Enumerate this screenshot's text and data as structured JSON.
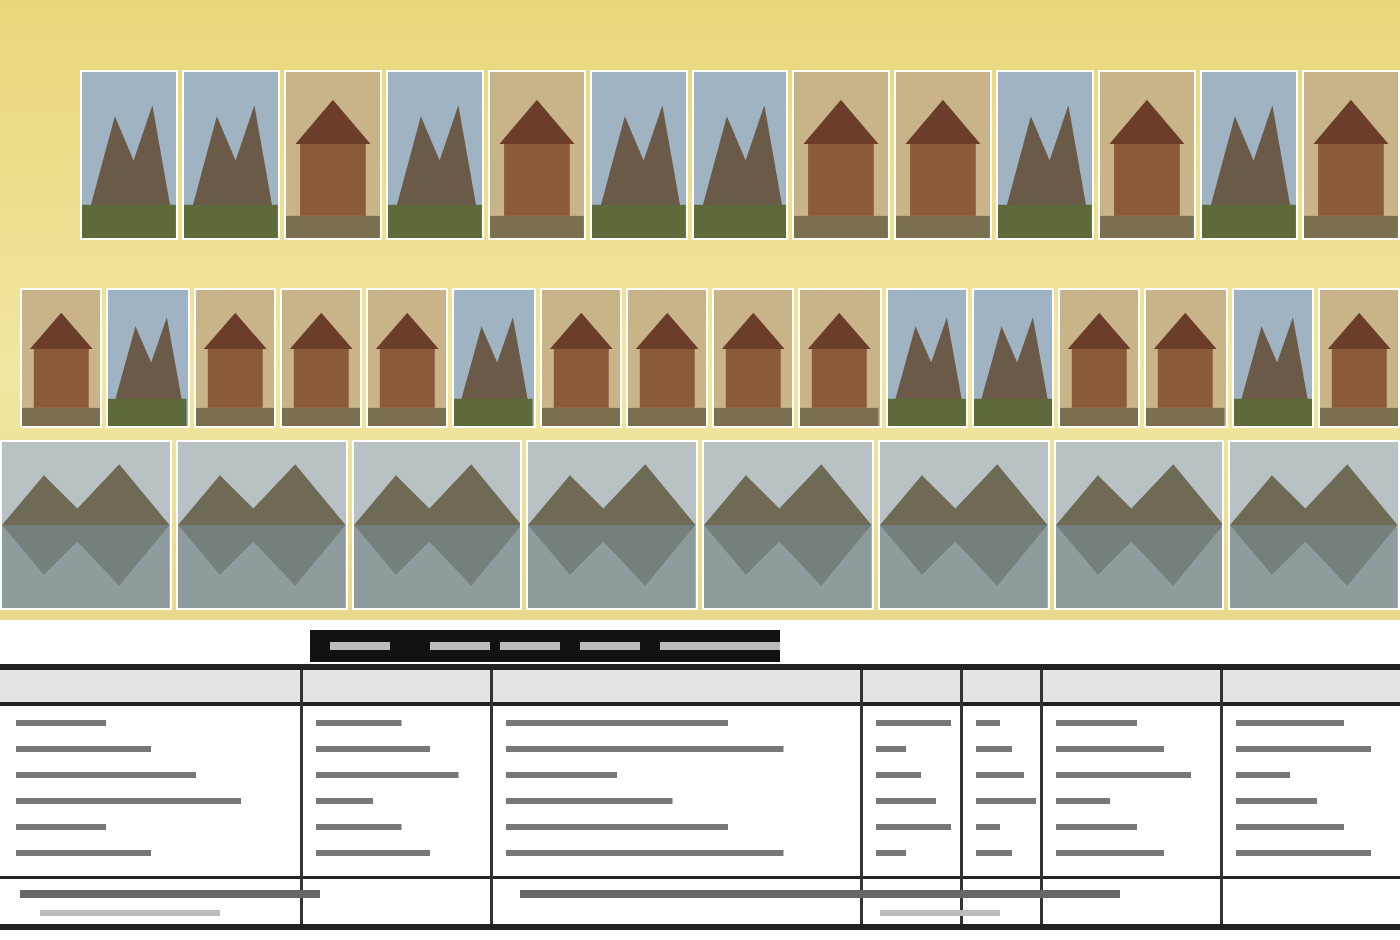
{
  "collage_rows": [
    {
      "photos": [
        {
          "kind": "mountain"
        },
        {
          "kind": "mountain"
        },
        {
          "kind": "building"
        },
        {
          "kind": "mountain"
        },
        {
          "kind": "building"
        },
        {
          "kind": "mountain"
        },
        {
          "kind": "mountain"
        },
        {
          "kind": "building"
        },
        {
          "kind": "building"
        },
        {
          "kind": "mountain"
        },
        {
          "kind": "building"
        },
        {
          "kind": "mountain"
        },
        {
          "kind": "building"
        }
      ]
    },
    {
      "photos": [
        {
          "kind": "building"
        },
        {
          "kind": "mountain"
        },
        {
          "kind": "building"
        },
        {
          "kind": "building"
        },
        {
          "kind": "building"
        },
        {
          "kind": "mountain"
        },
        {
          "kind": "building"
        },
        {
          "kind": "building"
        },
        {
          "kind": "building"
        },
        {
          "kind": "building"
        },
        {
          "kind": "mountain"
        },
        {
          "kind": "mountain"
        },
        {
          "kind": "building"
        },
        {
          "kind": "building"
        },
        {
          "kind": "mountain"
        },
        {
          "kind": "building"
        }
      ]
    },
    {
      "photos": [
        {
          "kind": "lake"
        },
        {
          "kind": "lake"
        },
        {
          "kind": "lake"
        },
        {
          "kind": "lake"
        },
        {
          "kind": "lake"
        },
        {
          "kind": "lake"
        },
        {
          "kind": "lake"
        },
        {
          "kind": "lake"
        }
      ]
    }
  ]
}
